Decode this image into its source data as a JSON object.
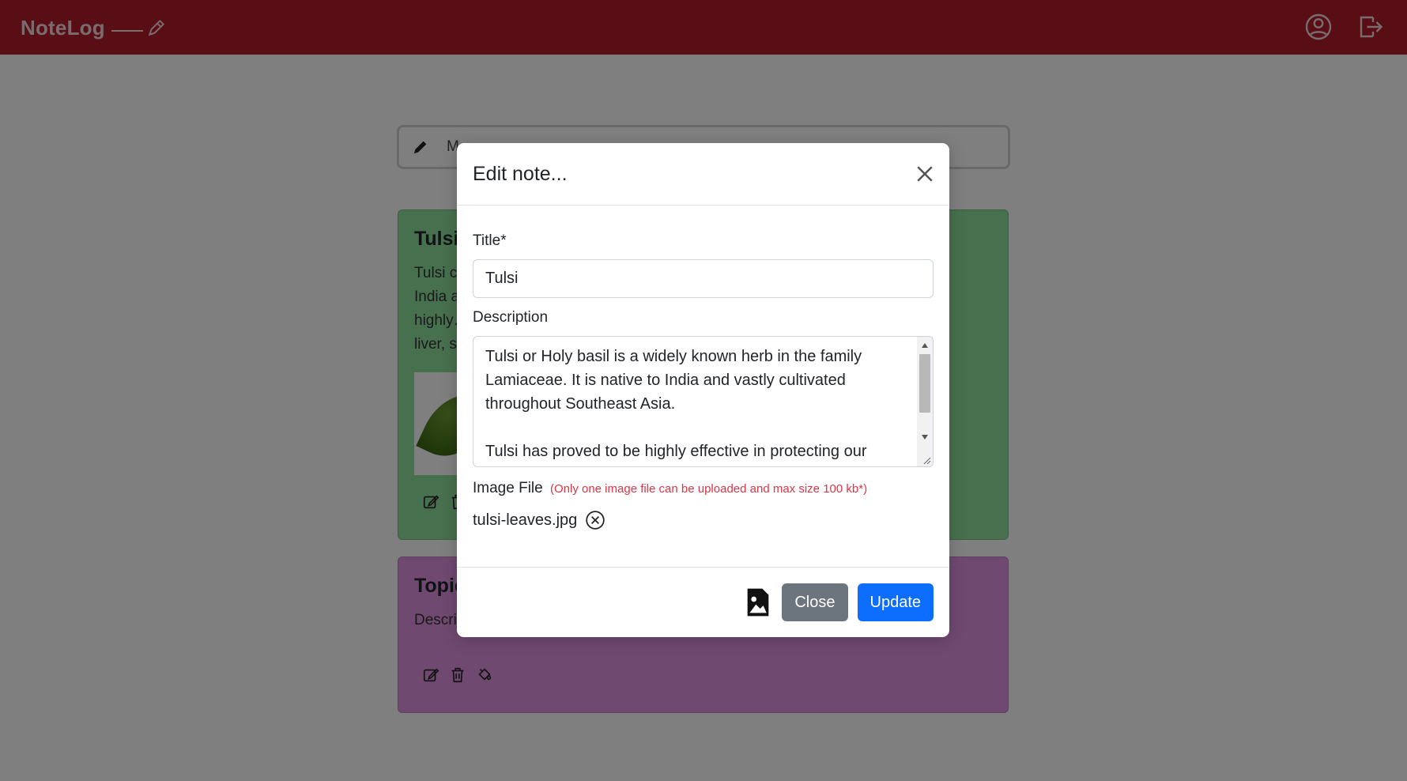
{
  "navbar": {
    "brand": "NoteLog",
    "icons": [
      "user-circle-icon",
      "logout-icon"
    ]
  },
  "search": {
    "placeholder": "M"
  },
  "notes": [
    {
      "title": "Tulsi",
      "color": "#8fe09d",
      "description": "Tulsi c… to\nIndia a…\nhighly… of the\nliver, s…",
      "has_image": true
    },
    {
      "title": "Topic",
      "color": "#e193e1",
      "description": "Descri"
    }
  ],
  "modal": {
    "title": "Edit note...",
    "title_label": "Title*",
    "title_value": "Tulsi",
    "description_label": "Description",
    "description_value": "Tulsi or Holy basil is a widely known herb in the family Lamiaceae. It is native to India and vastly cultivated throughout Southeast Asia.\n\nTulsi has proved to be highly effective in protecting our",
    "image_label": "Image File",
    "image_note": "(Only one image file can be uploaded and max size 100 kb*)",
    "file_name": "tulsi-leaves.jpg",
    "close_label": "Close",
    "update_label": "Update"
  },
  "colors": {
    "navbar": "#b31b2a",
    "primary": "#0d6efd",
    "secondary": "#6c757d",
    "danger": "#dc3545"
  }
}
